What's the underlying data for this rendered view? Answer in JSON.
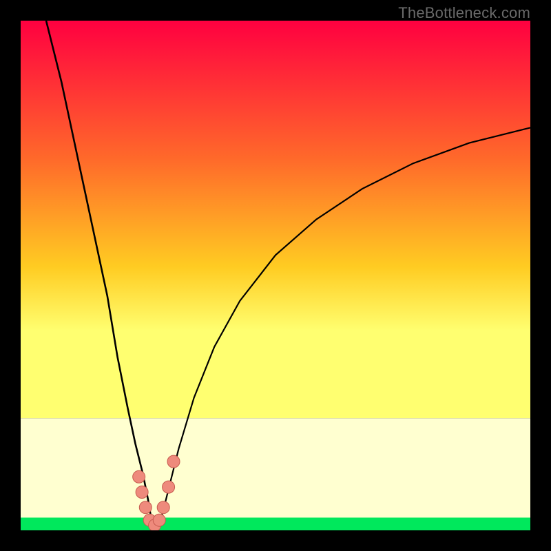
{
  "watermark": "TheBottleneck.com",
  "colors": {
    "top": "#ff0040",
    "mid_upper": "#ff6a2a",
    "mid": "#ffcc22",
    "mid_lower": "#ffff70",
    "pale_band": "#ffffd0",
    "green": "#00e85c",
    "curve": "#000000",
    "marker_fill": "#ee8a7c",
    "marker_stroke": "#c65a4e",
    "frame": "#000000"
  },
  "chart_data": {
    "type": "line",
    "title": "",
    "xlabel": "",
    "ylabel": "",
    "xlim": [
      0,
      100
    ],
    "ylim": [
      0,
      100
    ],
    "optimum_x": 26,
    "curve_left": {
      "x": [
        5,
        8,
        11,
        14,
        17,
        19,
        21,
        22.5,
        24,
        25,
        25.5,
        26
      ],
      "y": [
        100,
        88,
        74,
        60,
        46,
        34,
        24,
        17,
        11,
        6,
        3,
        0.5
      ]
    },
    "curve_right": {
      "x": [
        27,
        28,
        29.5,
        31,
        34,
        38,
        43,
        50,
        58,
        67,
        77,
        88,
        100
      ],
      "y": [
        0.5,
        4,
        10,
        16,
        26,
        36,
        45,
        54,
        61,
        67,
        72,
        76,
        79
      ]
    },
    "markers": [
      {
        "x": 23.2,
        "y": 10.5
      },
      {
        "x": 23.8,
        "y": 7.5
      },
      {
        "x": 24.5,
        "y": 4.5
      },
      {
        "x": 25.3,
        "y": 2.0
      },
      {
        "x": 26.3,
        "y": 1.0
      },
      {
        "x": 27.2,
        "y": 2.0
      },
      {
        "x": 28.0,
        "y": 4.5
      },
      {
        "x": 29.0,
        "y": 8.5
      },
      {
        "x": 30.0,
        "y": 13.5
      }
    ],
    "green_band_y": [
      0,
      2.5
    ],
    "pale_band_y": [
      2.5,
      22
    ]
  }
}
